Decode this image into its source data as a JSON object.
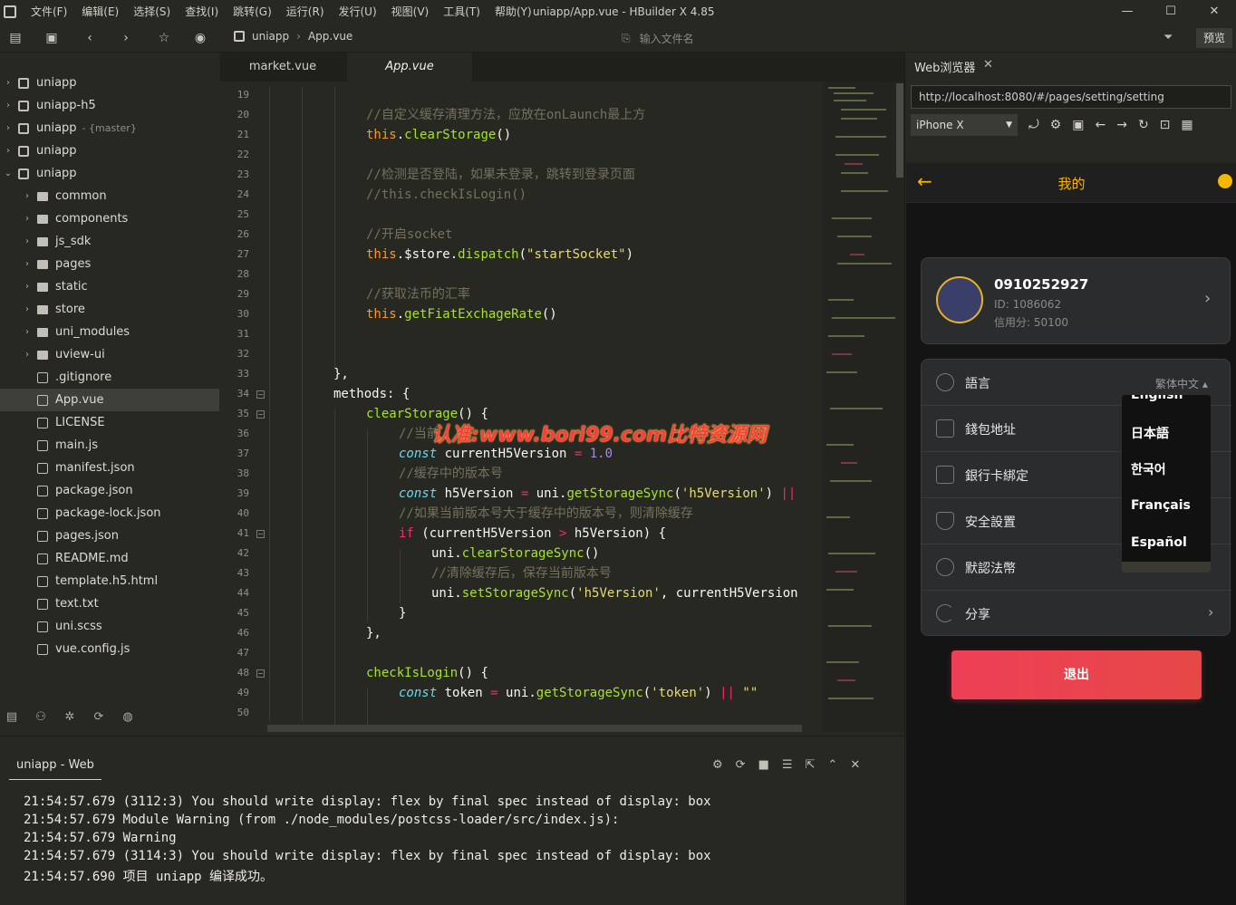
{
  "window": {
    "menus": [
      "文件(F)",
      "编辑(E)",
      "选择(S)",
      "查找(I)",
      "跳转(G)",
      "运行(R)",
      "发行(U)",
      "视图(V)",
      "工具(T)",
      "帮助(Y)"
    ],
    "title": "uniapp/App.vue - HBuilder X 4.85",
    "controls": [
      "—",
      "☐",
      "✕"
    ]
  },
  "toolbar": {
    "breadcrumb": [
      "uniapp",
      "App.vue"
    ],
    "file_search_placeholder": "输入文件名",
    "preview_label": "预览"
  },
  "sidebar": {
    "items": [
      {
        "label": "uniapp",
        "kind": "project",
        "depth": 0,
        "chev": "›"
      },
      {
        "label": "uniapp-h5",
        "kind": "project",
        "depth": 0,
        "chev": "›"
      },
      {
        "label": "uniapp",
        "branch": "- {master}",
        "kind": "project",
        "depth": 0,
        "chev": "›"
      },
      {
        "label": "uniapp",
        "kind": "project",
        "depth": 0,
        "chev": "›"
      },
      {
        "label": "uniapp",
        "kind": "project",
        "depth": 0,
        "chev": "⌄"
      },
      {
        "label": "common",
        "kind": "folder",
        "depth": 1,
        "chev": "›"
      },
      {
        "label": "components",
        "kind": "folder",
        "depth": 1,
        "chev": "›"
      },
      {
        "label": "js_sdk",
        "kind": "folder",
        "depth": 1,
        "chev": "›"
      },
      {
        "label": "pages",
        "kind": "folder",
        "depth": 1,
        "chev": "›"
      },
      {
        "label": "static",
        "kind": "folder",
        "depth": 1,
        "chev": "›"
      },
      {
        "label": "store",
        "kind": "folder",
        "depth": 1,
        "chev": "›"
      },
      {
        "label": "uni_modules",
        "kind": "folder",
        "depth": 1,
        "chev": "›"
      },
      {
        "label": "uview-ui",
        "kind": "folder",
        "depth": 1,
        "chev": "›"
      },
      {
        "label": ".gitignore",
        "kind": "file",
        "depth": 1,
        "chev": ""
      },
      {
        "label": "App.vue",
        "kind": "file",
        "depth": 1,
        "chev": "",
        "selected": true
      },
      {
        "label": "LICENSE",
        "kind": "file",
        "depth": 1,
        "chev": ""
      },
      {
        "label": "main.js",
        "kind": "file",
        "depth": 1,
        "chev": ""
      },
      {
        "label": "manifest.json",
        "kind": "file",
        "depth": 1,
        "chev": ""
      },
      {
        "label": "package.json",
        "kind": "file",
        "depth": 1,
        "chev": ""
      },
      {
        "label": "package-lock.json",
        "kind": "file",
        "depth": 1,
        "chev": ""
      },
      {
        "label": "pages.json",
        "kind": "file",
        "depth": 1,
        "chev": ""
      },
      {
        "label": "README.md",
        "kind": "file",
        "depth": 1,
        "chev": ""
      },
      {
        "label": "template.h5.html",
        "kind": "file",
        "depth": 1,
        "chev": ""
      },
      {
        "label": "text.txt",
        "kind": "file",
        "depth": 1,
        "chev": ""
      },
      {
        "label": "uni.scss",
        "kind": "file",
        "depth": 1,
        "chev": ""
      },
      {
        "label": "vue.config.js",
        "kind": "file",
        "depth": 1,
        "chev": ""
      }
    ]
  },
  "editor": {
    "tabs": [
      {
        "label": "market.vue",
        "active": false
      },
      {
        "label": "App.vue",
        "active": true
      }
    ],
    "line_numbers": [
      "19",
      "20",
      "21",
      "22",
      "23",
      "24",
      "25",
      "26",
      "27",
      "28",
      "29",
      "30",
      "31",
      "32",
      "33",
      "34",
      "35",
      "36",
      "37",
      "38",
      "39",
      "40",
      "41",
      "42",
      "43",
      "44",
      "45",
      "46",
      "47",
      "48",
      "49",
      "50"
    ],
    "watermark": "认准:www.bori99.com比特资源网"
  },
  "console": {
    "tab_label": "uniapp - Web",
    "lines": [
      "21:54:57.679 (3112:3) You should write display: flex by final spec instead of display: box",
      "21:54:57.679 Module Warning (from ./node_modules/postcss-loader/src/index.js):",
      "21:54:57.679 Warning",
      "21:54:57.679 (3114:3) You should write display: flex by final spec instead of display: box",
      "21:54:57.690 项目 uniapp 编译成功。"
    ]
  },
  "browser": {
    "tab_label": "Web浏览器",
    "url": "http://localhost:8080/#/pages/setting/setting",
    "device": "iPhone X",
    "app": {
      "title": "我的",
      "user": {
        "phone": "0910252927",
        "id": "ID: 1086062",
        "credit": "信用分: 50100"
      },
      "menu": [
        "語言",
        "錢包地址",
        "銀行卡綁定",
        "安全設置",
        "默認法幣",
        "分享"
      ],
      "language_value": "繁体中文",
      "language_options": [
        "English",
        "日本語",
        "한국어",
        "Français",
        "Español"
      ],
      "logout_label": "退出"
    }
  }
}
